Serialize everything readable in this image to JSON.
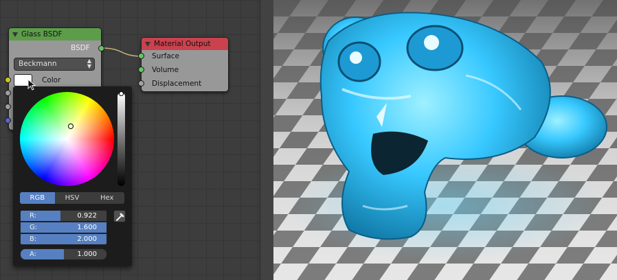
{
  "glass_node": {
    "title": "Glass BSDF",
    "output_label": "BSDF",
    "distribution": "Beckmann",
    "color_label": "Color",
    "color_value": "#ffffff"
  },
  "material_node": {
    "title": "Material Output",
    "inputs": [
      "Surface",
      "Volume",
      "Displacement"
    ]
  },
  "color_picker": {
    "modes": [
      "RGB",
      "HSV",
      "Hex"
    ],
    "active_mode": "RGB",
    "fields": [
      {
        "label": "R:",
        "value": "0.922",
        "fraction": 0.46
      },
      {
        "label": "G:",
        "value": "1.600",
        "fraction": 1.0
      },
      {
        "label": "B:",
        "value": "2.000",
        "fraction": 1.0
      },
      {
        "label": "A:",
        "value": "1.000",
        "fraction": 0.5
      }
    ],
    "value_level": 1.0
  },
  "render": {
    "subject": "glass-monkey",
    "glass_color": "#37c8ff"
  }
}
